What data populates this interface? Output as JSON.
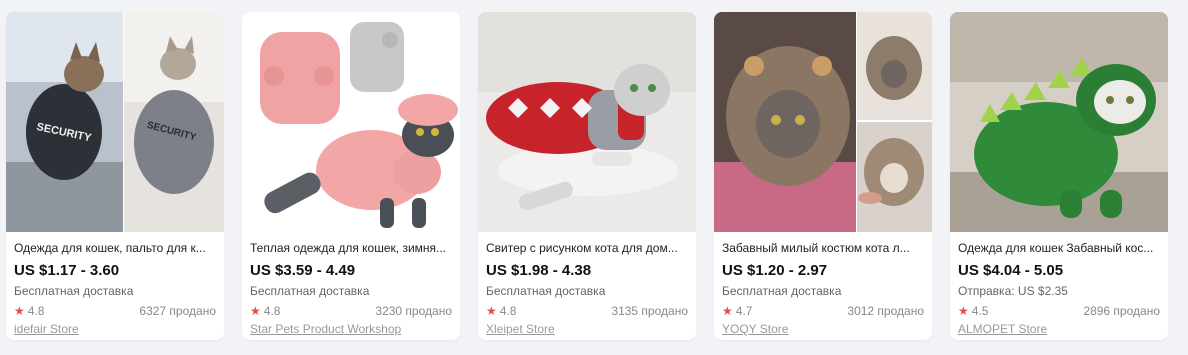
{
  "colors": {
    "page_bg": "#f2f3f6",
    "card_bg": "#ffffff",
    "star": "#e84a4a",
    "price": "#111111",
    "muted": "#888888"
  },
  "products": [
    {
      "title": "Одежда для кошек, пальто для к...",
      "price": "US $1.17 - 3.60",
      "shipping": "Бесплатная доставка",
      "rating": "4.8",
      "sold": "6327 продано",
      "store": "idefair Store",
      "image_icon": "cat-security-hoodie-photo"
    },
    {
      "title": "Теплая одежда для кошек, зимня...",
      "price": "US $3.59 - 4.49",
      "shipping": "Бесплатная доставка",
      "rating": "4.8",
      "sold": "3230 продано",
      "store": "Star Pets Product Workshop",
      "image_icon": "cat-pink-fleece-hoodie-photo"
    },
    {
      "title": "Свитер с рисунком кота для дом...",
      "price": "US $1.98 - 4.38",
      "shipping": "Бесплатная доставка",
      "rating": "4.8",
      "sold": "3135 продано",
      "store": "Xleipet Store",
      "image_icon": "cat-red-knit-sweater-photo"
    },
    {
      "title": "Забавный милый костюм кота л...",
      "price": "US $1.20 - 2.97",
      "shipping": "Бесплатная доставка",
      "rating": "4.7",
      "sold": "3012 продано",
      "store": "YOQY Store",
      "image_icon": "cat-lion-mane-costume-photo"
    },
    {
      "title": "Одежда для кошек Забавный кос...",
      "price": "US $4.04 - 5.05",
      "shipping": "Отправка: US $2.35",
      "rating": "4.5",
      "sold": "2896 продано",
      "store": "ALMOPET Store",
      "image_icon": "cat-green-dinosaur-costume-photo"
    }
  ]
}
